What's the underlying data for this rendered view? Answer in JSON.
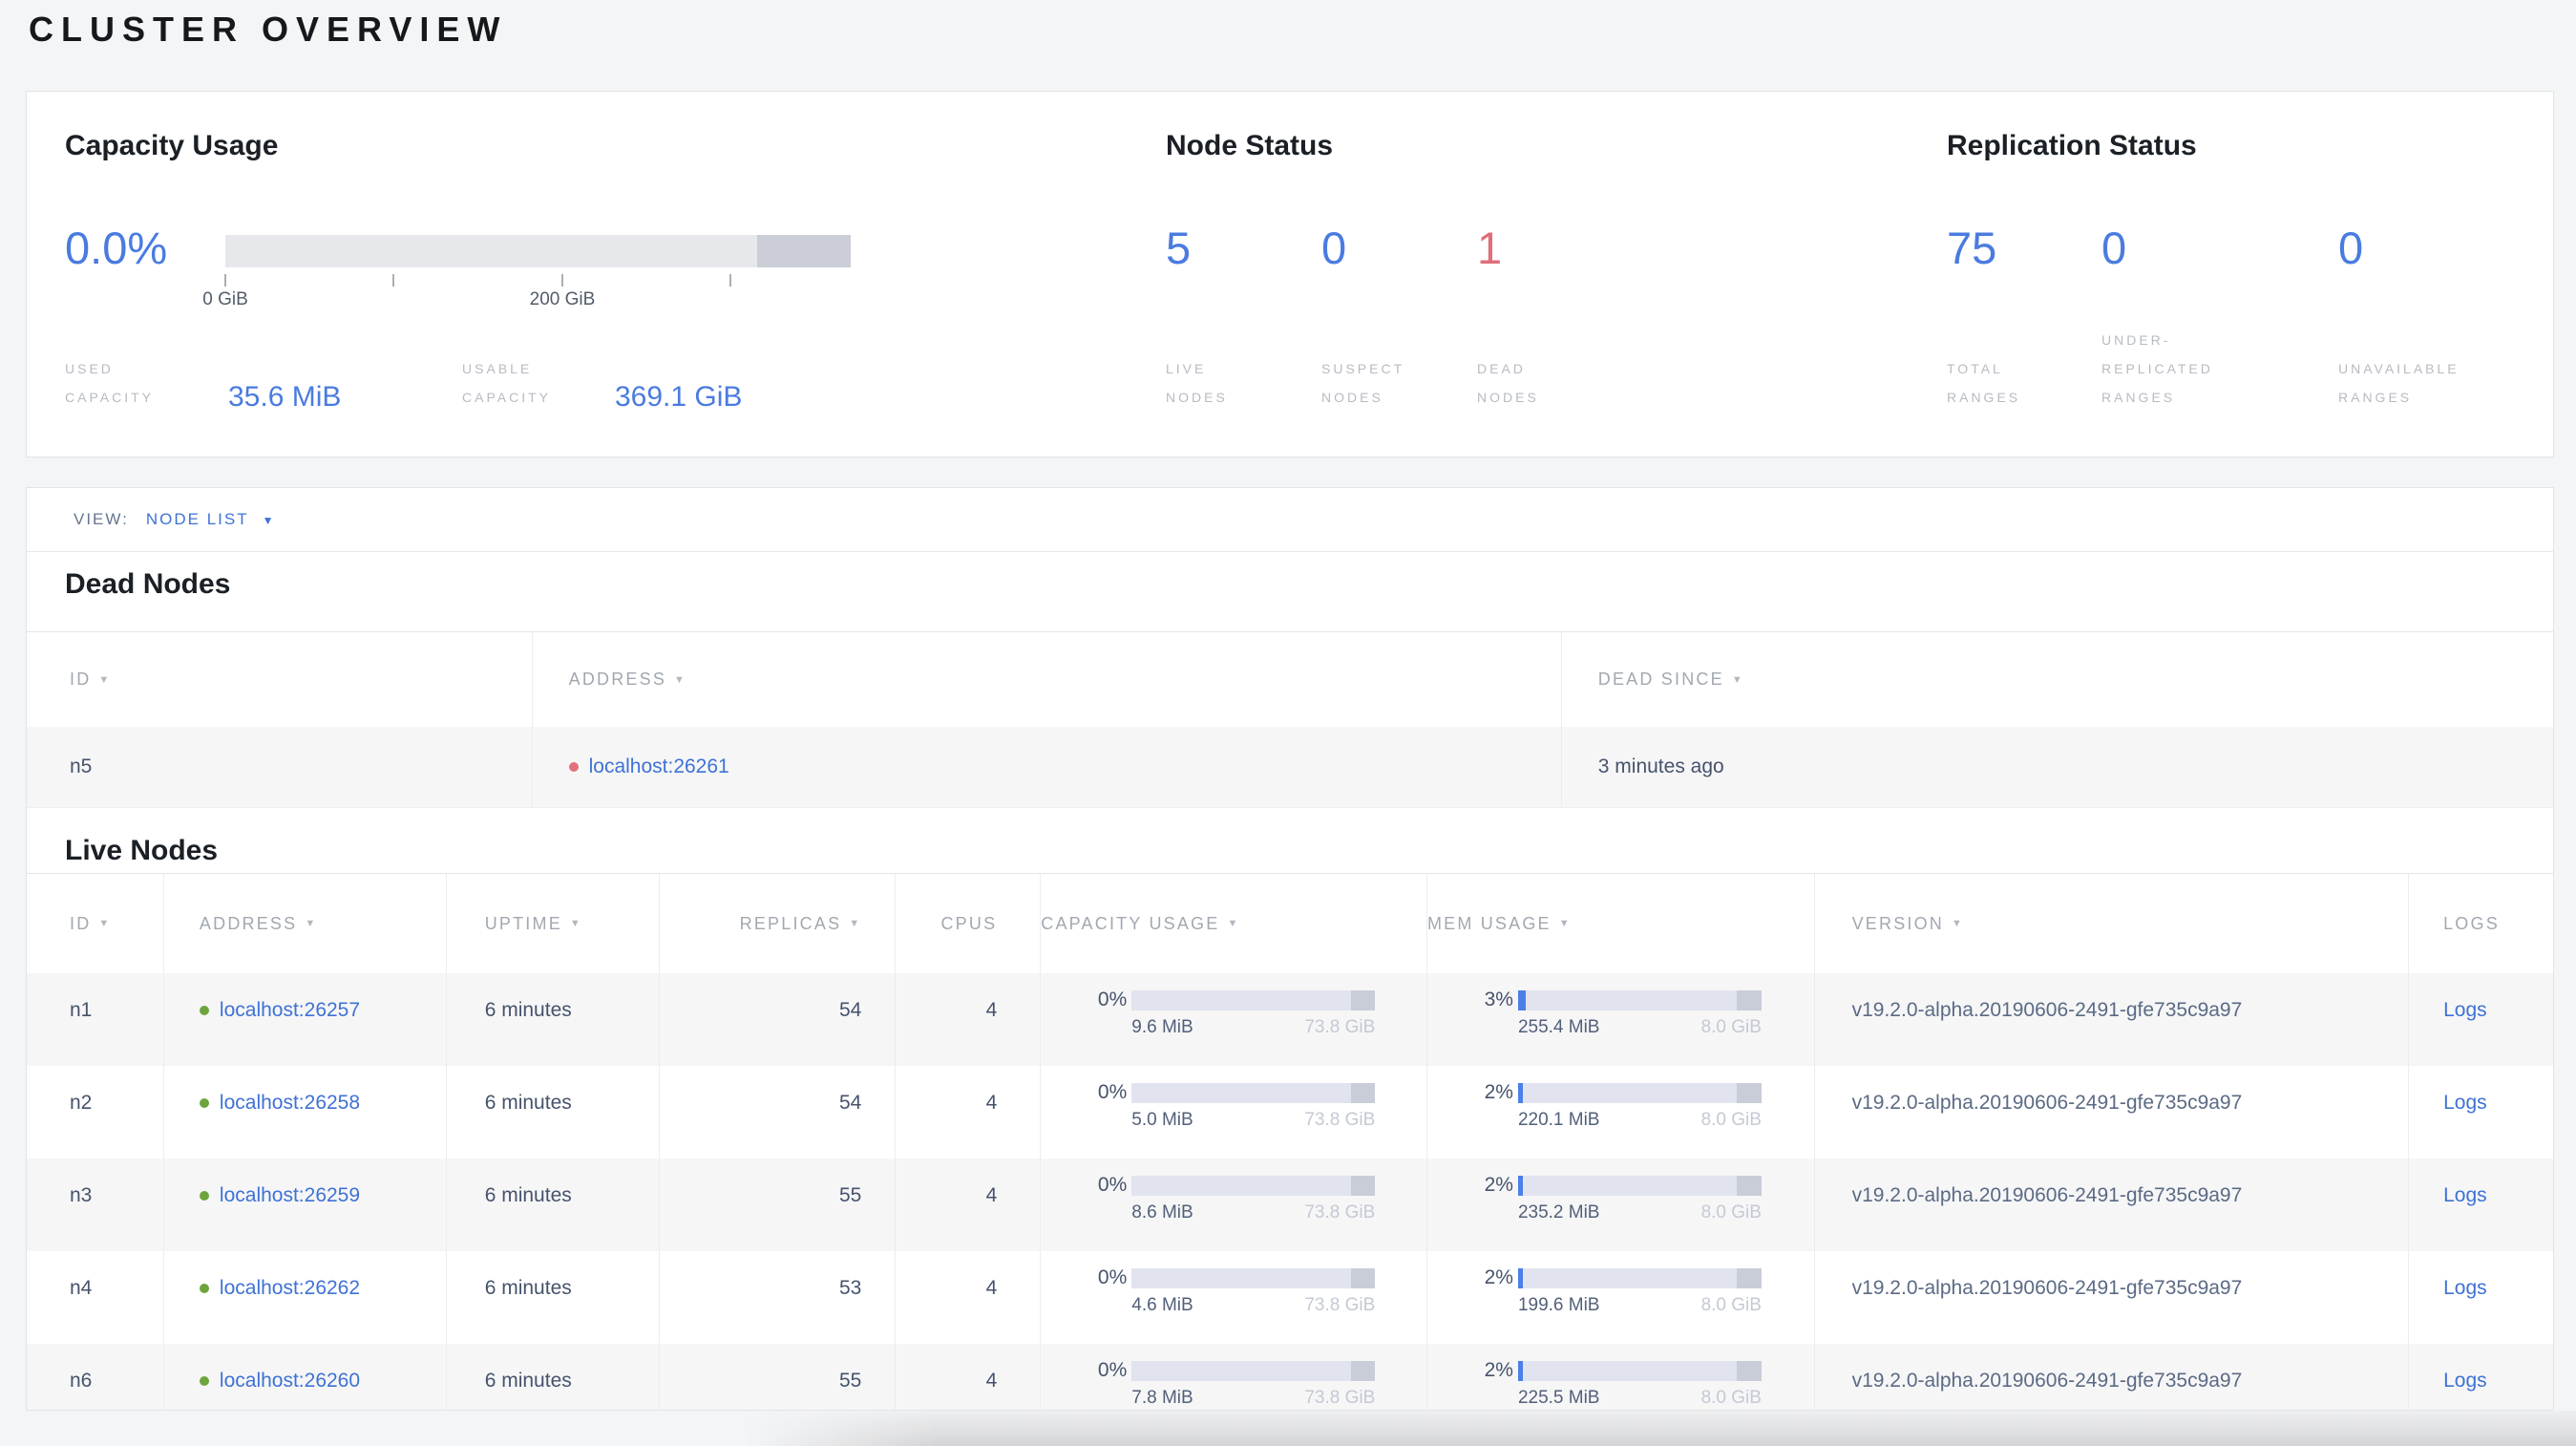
{
  "page": {
    "title": "CLUSTER OVERVIEW"
  },
  "colors": {
    "accent_blue": "#3e72d4",
    "stat_blue": "#4a7be0",
    "dead_red": "#df6e7a",
    "live_green": "#6da53c"
  },
  "capacity": {
    "title": "Capacity Usage",
    "percent": "0.0%",
    "tick_labels": [
      "0 GiB",
      "200 GiB"
    ],
    "used_label": "USED\nCAPACITY",
    "used_value": "35.6 MiB",
    "usable_label": "USABLE\nCAPACITY",
    "usable_value": "369.1 GiB"
  },
  "node_status": {
    "title": "Node Status",
    "stats": [
      {
        "value": "5",
        "label": "LIVE\nNODES"
      },
      {
        "value": "0",
        "label": "SUSPECT\nNODES"
      },
      {
        "value": "1",
        "label": "DEAD\nNODES"
      }
    ]
  },
  "replication": {
    "title": "Replication Status",
    "stats": [
      {
        "value": "75",
        "label": "TOTAL\nRANGES"
      },
      {
        "value": "0",
        "label": "UNDER-\nREPLICATED\nRANGES"
      },
      {
        "value": "0",
        "label": "UNAVAILABLE\nRANGES"
      }
    ]
  },
  "view_bar": {
    "label": "VIEW:",
    "selected": "NODE LIST"
  },
  "dead_nodes": {
    "heading": "Dead Nodes",
    "columns": [
      {
        "label": "ID",
        "sortable": true
      },
      {
        "label": "ADDRESS",
        "sortable": true
      },
      {
        "label": "DEAD SINCE",
        "sortable": true
      }
    ],
    "rows": [
      {
        "id": "n5",
        "address": "localhost:26261",
        "dead_since": "3 minutes ago"
      }
    ]
  },
  "live_nodes": {
    "heading": "Live Nodes",
    "columns": [
      {
        "label": "ID",
        "sortable": true
      },
      {
        "label": "ADDRESS",
        "sortable": true
      },
      {
        "label": "UPTIME",
        "sortable": true
      },
      {
        "label": "REPLICAS",
        "sortable": true
      },
      {
        "label": "CPUS",
        "sortable": false
      },
      {
        "label": "CAPACITY USAGE",
        "sortable": true
      },
      {
        "label": "MEM USAGE",
        "sortable": true
      },
      {
        "label": "VERSION",
        "sortable": true
      },
      {
        "label": "LOGS",
        "sortable": false
      }
    ],
    "rows": [
      {
        "id": "n1",
        "address": "localhost:26257",
        "uptime": "6 minutes",
        "replicas": "54",
        "cpus": "4",
        "capacity": {
          "percent": "0%",
          "value": "9.6 MiB",
          "total": "73.8 GiB",
          "fill": 0
        },
        "memory": {
          "percent": "3%",
          "value": "255.4 MiB",
          "total": "8.0 GiB",
          "fill": 3
        },
        "version": "v19.2.0-alpha.20190606-2491-gfe735c9a97",
        "logs": "Logs"
      },
      {
        "id": "n2",
        "address": "localhost:26258",
        "uptime": "6 minutes",
        "replicas": "54",
        "cpus": "4",
        "capacity": {
          "percent": "0%",
          "value": "5.0 MiB",
          "total": "73.8 GiB",
          "fill": 0
        },
        "memory": {
          "percent": "2%",
          "value": "220.1 MiB",
          "total": "8.0 GiB",
          "fill": 2
        },
        "version": "v19.2.0-alpha.20190606-2491-gfe735c9a97",
        "logs": "Logs"
      },
      {
        "id": "n3",
        "address": "localhost:26259",
        "uptime": "6 minutes",
        "replicas": "55",
        "cpus": "4",
        "capacity": {
          "percent": "0%",
          "value": "8.6 MiB",
          "total": "73.8 GiB",
          "fill": 0
        },
        "memory": {
          "percent": "2%",
          "value": "235.2 MiB",
          "total": "8.0 GiB",
          "fill": 2
        },
        "version": "v19.2.0-alpha.20190606-2491-gfe735c9a97",
        "logs": "Logs"
      },
      {
        "id": "n4",
        "address": "localhost:26262",
        "uptime": "6 minutes",
        "replicas": "53",
        "cpus": "4",
        "capacity": {
          "percent": "0%",
          "value": "4.6 MiB",
          "total": "73.8 GiB",
          "fill": 0
        },
        "memory": {
          "percent": "2%",
          "value": "199.6 MiB",
          "total": "8.0 GiB",
          "fill": 2
        },
        "version": "v19.2.0-alpha.20190606-2491-gfe735c9a97",
        "logs": "Logs"
      },
      {
        "id": "n6",
        "address": "localhost:26260",
        "uptime": "6 minutes",
        "replicas": "55",
        "cpus": "4",
        "capacity": {
          "percent": "0%",
          "value": "7.8 MiB",
          "total": "73.8 GiB",
          "fill": 0
        },
        "memory": {
          "percent": "2%",
          "value": "225.5 MiB",
          "total": "8.0 GiB",
          "fill": 2
        },
        "version": "v19.2.0-alpha.20190606-2491-gfe735c9a97",
        "logs": "Logs"
      }
    ]
  }
}
